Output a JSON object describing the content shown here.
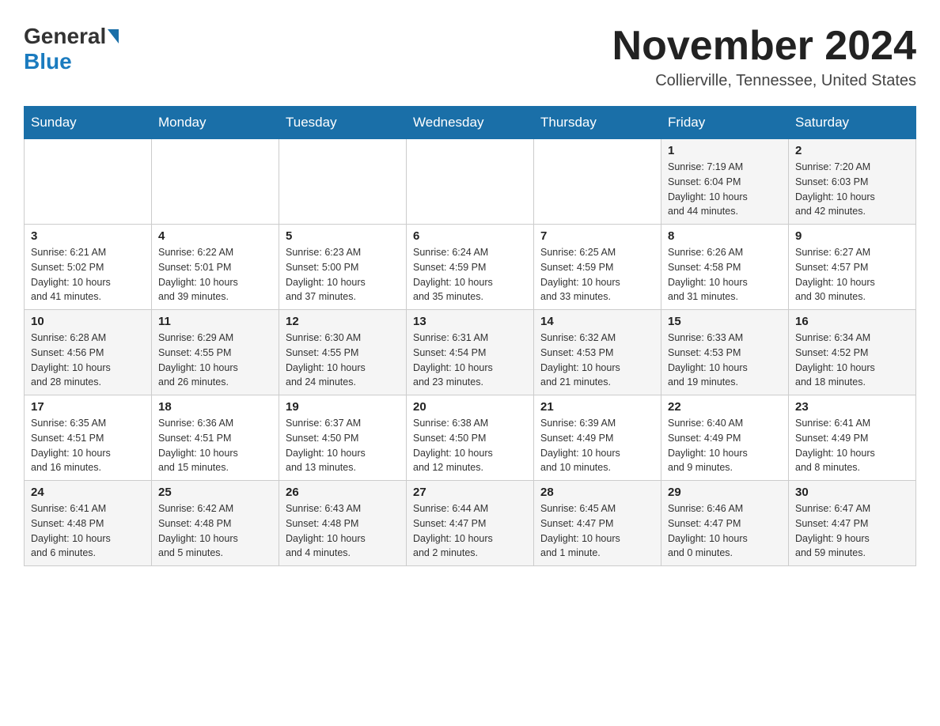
{
  "header": {
    "logo_general": "General",
    "logo_blue": "Blue",
    "month_title": "November 2024",
    "location": "Collierville, Tennessee, United States"
  },
  "weekdays": [
    "Sunday",
    "Monday",
    "Tuesday",
    "Wednesday",
    "Thursday",
    "Friday",
    "Saturday"
  ],
  "weeks": [
    [
      {
        "day": "",
        "info": ""
      },
      {
        "day": "",
        "info": ""
      },
      {
        "day": "",
        "info": ""
      },
      {
        "day": "",
        "info": ""
      },
      {
        "day": "",
        "info": ""
      },
      {
        "day": "1",
        "info": "Sunrise: 7:19 AM\nSunset: 6:04 PM\nDaylight: 10 hours\nand 44 minutes."
      },
      {
        "day": "2",
        "info": "Sunrise: 7:20 AM\nSunset: 6:03 PM\nDaylight: 10 hours\nand 42 minutes."
      }
    ],
    [
      {
        "day": "3",
        "info": "Sunrise: 6:21 AM\nSunset: 5:02 PM\nDaylight: 10 hours\nand 41 minutes."
      },
      {
        "day": "4",
        "info": "Sunrise: 6:22 AM\nSunset: 5:01 PM\nDaylight: 10 hours\nand 39 minutes."
      },
      {
        "day": "5",
        "info": "Sunrise: 6:23 AM\nSunset: 5:00 PM\nDaylight: 10 hours\nand 37 minutes."
      },
      {
        "day": "6",
        "info": "Sunrise: 6:24 AM\nSunset: 4:59 PM\nDaylight: 10 hours\nand 35 minutes."
      },
      {
        "day": "7",
        "info": "Sunrise: 6:25 AM\nSunset: 4:59 PM\nDaylight: 10 hours\nand 33 minutes."
      },
      {
        "day": "8",
        "info": "Sunrise: 6:26 AM\nSunset: 4:58 PM\nDaylight: 10 hours\nand 31 minutes."
      },
      {
        "day": "9",
        "info": "Sunrise: 6:27 AM\nSunset: 4:57 PM\nDaylight: 10 hours\nand 30 minutes."
      }
    ],
    [
      {
        "day": "10",
        "info": "Sunrise: 6:28 AM\nSunset: 4:56 PM\nDaylight: 10 hours\nand 28 minutes."
      },
      {
        "day": "11",
        "info": "Sunrise: 6:29 AM\nSunset: 4:55 PM\nDaylight: 10 hours\nand 26 minutes."
      },
      {
        "day": "12",
        "info": "Sunrise: 6:30 AM\nSunset: 4:55 PM\nDaylight: 10 hours\nand 24 minutes."
      },
      {
        "day": "13",
        "info": "Sunrise: 6:31 AM\nSunset: 4:54 PM\nDaylight: 10 hours\nand 23 minutes."
      },
      {
        "day": "14",
        "info": "Sunrise: 6:32 AM\nSunset: 4:53 PM\nDaylight: 10 hours\nand 21 minutes."
      },
      {
        "day": "15",
        "info": "Sunrise: 6:33 AM\nSunset: 4:53 PM\nDaylight: 10 hours\nand 19 minutes."
      },
      {
        "day": "16",
        "info": "Sunrise: 6:34 AM\nSunset: 4:52 PM\nDaylight: 10 hours\nand 18 minutes."
      }
    ],
    [
      {
        "day": "17",
        "info": "Sunrise: 6:35 AM\nSunset: 4:51 PM\nDaylight: 10 hours\nand 16 minutes."
      },
      {
        "day": "18",
        "info": "Sunrise: 6:36 AM\nSunset: 4:51 PM\nDaylight: 10 hours\nand 15 minutes."
      },
      {
        "day": "19",
        "info": "Sunrise: 6:37 AM\nSunset: 4:50 PM\nDaylight: 10 hours\nand 13 minutes."
      },
      {
        "day": "20",
        "info": "Sunrise: 6:38 AM\nSunset: 4:50 PM\nDaylight: 10 hours\nand 12 minutes."
      },
      {
        "day": "21",
        "info": "Sunrise: 6:39 AM\nSunset: 4:49 PM\nDaylight: 10 hours\nand 10 minutes."
      },
      {
        "day": "22",
        "info": "Sunrise: 6:40 AM\nSunset: 4:49 PM\nDaylight: 10 hours\nand 9 minutes."
      },
      {
        "day": "23",
        "info": "Sunrise: 6:41 AM\nSunset: 4:49 PM\nDaylight: 10 hours\nand 8 minutes."
      }
    ],
    [
      {
        "day": "24",
        "info": "Sunrise: 6:41 AM\nSunset: 4:48 PM\nDaylight: 10 hours\nand 6 minutes."
      },
      {
        "day": "25",
        "info": "Sunrise: 6:42 AM\nSunset: 4:48 PM\nDaylight: 10 hours\nand 5 minutes."
      },
      {
        "day": "26",
        "info": "Sunrise: 6:43 AM\nSunset: 4:48 PM\nDaylight: 10 hours\nand 4 minutes."
      },
      {
        "day": "27",
        "info": "Sunrise: 6:44 AM\nSunset: 4:47 PM\nDaylight: 10 hours\nand 2 minutes."
      },
      {
        "day": "28",
        "info": "Sunrise: 6:45 AM\nSunset: 4:47 PM\nDaylight: 10 hours\nand 1 minute."
      },
      {
        "day": "29",
        "info": "Sunrise: 6:46 AM\nSunset: 4:47 PM\nDaylight: 10 hours\nand 0 minutes."
      },
      {
        "day": "30",
        "info": "Sunrise: 6:47 AM\nSunset: 4:47 PM\nDaylight: 9 hours\nand 59 minutes."
      }
    ]
  ]
}
